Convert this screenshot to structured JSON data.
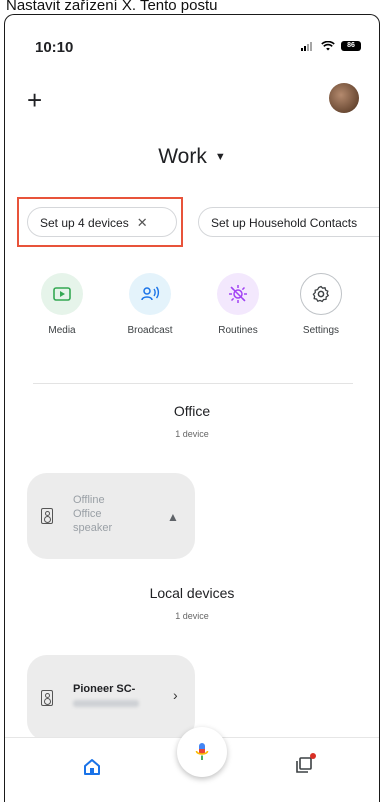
{
  "caption": {
    "text": "Nastavit zařízení X. Tento postu"
  },
  "status_bar": {
    "time": "10:10",
    "battery": "86"
  },
  "header": {
    "home_name": "Work"
  },
  "chips": [
    {
      "label": "Set up 4 devices",
      "close_glyph": "✕"
    },
    {
      "label": "Set up Household Contacts"
    }
  ],
  "quick_actions": [
    {
      "label": "Media",
      "icon": "media-icon",
      "color": "#34a853"
    },
    {
      "label": "Broadcast",
      "icon": "broadcast-icon",
      "color": "#1a73e8"
    },
    {
      "label": "Routines",
      "icon": "routines-icon",
      "color": "#a142f4"
    },
    {
      "label": "Settings",
      "icon": "gear-icon",
      "color": "#3c4043"
    }
  ],
  "rooms": [
    {
      "title": "Office",
      "subtitle": "1 device",
      "device": {
        "status": "Offline",
        "name": "Office speaker",
        "icon": "speaker-icon",
        "badge": "warning-icon"
      }
    },
    {
      "title": "Local devices",
      "subtitle": "1 device",
      "device": {
        "name": "Pioneer SC-",
        "icon": "speaker-icon"
      }
    }
  ],
  "bottom_nav": {
    "home_icon": "home-icon",
    "feed_icon": "feed-icon",
    "accent": "#1a73e8"
  },
  "highlight_color": "#e8533a"
}
